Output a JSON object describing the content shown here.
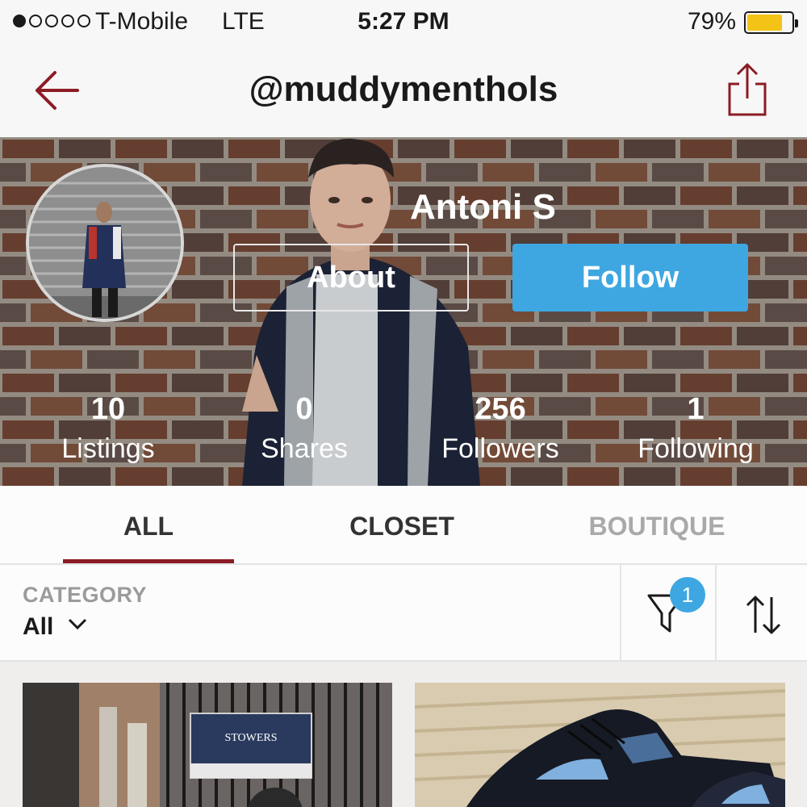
{
  "status_bar": {
    "carrier": "T-Mobile",
    "network": "LTE",
    "time": "5:27 PM",
    "battery": "79%",
    "battery_level": 0.79,
    "signal_bars": 1
  },
  "nav": {
    "title": "@muddymenthols",
    "back_icon": "back-arrow-icon",
    "share_icon": "share-icon",
    "accent": "#8c1c24"
  },
  "profile": {
    "name": "Antoni S",
    "about_label": "About",
    "follow_label": "Follow",
    "follow_color": "#3ea7e1",
    "stats": [
      {
        "value": "10",
        "label": "Listings"
      },
      {
        "value": "0",
        "label": "Shares"
      },
      {
        "value": "256",
        "label": "Followers"
      },
      {
        "value": "1",
        "label": "Following"
      }
    ]
  },
  "tabs": [
    {
      "label": "ALL",
      "active": true
    },
    {
      "label": "CLOSET",
      "active": false
    },
    {
      "label": "BOUTIQUE",
      "active": false
    }
  ],
  "filter": {
    "category_label": "CATEGORY",
    "category_value": "All",
    "filter_count": "1",
    "filter_icon": "funnel-icon",
    "sort_icon": "sort-arrows-icon"
  },
  "listings": [
    {
      "sign_text": "STOWERS"
    },
    {}
  ]
}
